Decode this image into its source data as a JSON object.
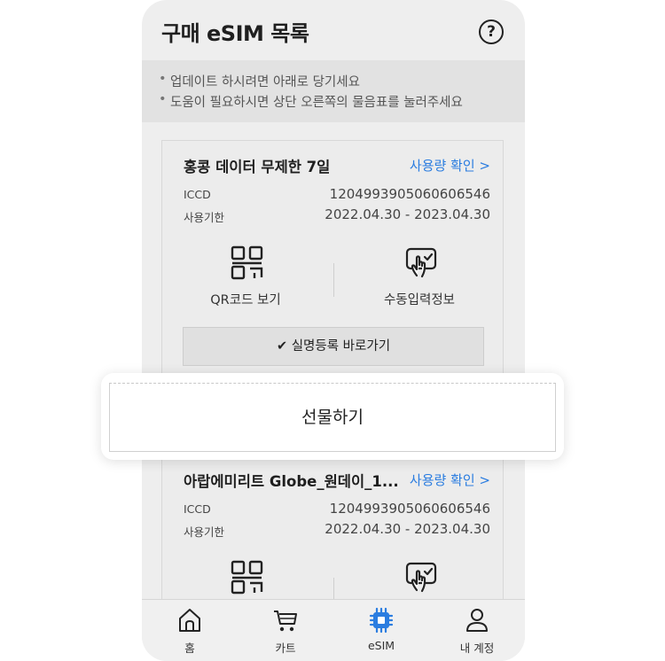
{
  "header": {
    "title": "구매 eSIM 목록",
    "help_label": "?"
  },
  "notice": [
    "업데이트 하시려면 아래로 당기세요",
    "도움이 필요하시면 상단 오른쪽의 물음표를 눌러주세요"
  ],
  "cards": [
    {
      "name": "홍콩 데이터 무제한 7일",
      "usage_link": "사용량 확인 >",
      "iccd_label": "ICCD",
      "iccd": "1204993905060606546",
      "expiry_label": "사용기한",
      "expiry": "2022.04.30 - 2023.04.30",
      "qr_label": "QR코드 보기",
      "manual_label": "수동입력정보",
      "register_label": "✔ 실명등록 바로가기"
    },
    {
      "name": "아랍에미리트 Globe_원데이_1...",
      "usage_link": "사용량 확인 >",
      "iccd_label": "ICCD",
      "iccd": "1204993905060606546",
      "expiry_label": "사용기한",
      "expiry": "2022.04.30 - 2023.04.30"
    }
  ],
  "gift_button": "선물하기",
  "tabs": [
    {
      "label": "홈",
      "icon": "home-icon"
    },
    {
      "label": "카트",
      "icon": "cart-icon"
    },
    {
      "label": "eSIM",
      "icon": "esim-chip-icon",
      "active": true
    },
    {
      "label": "내 계정",
      "icon": "user-icon"
    }
  ],
  "colors": {
    "accent": "#2b7de0",
    "active_tab": "#2b7de0",
    "background": "#eeeeee"
  }
}
